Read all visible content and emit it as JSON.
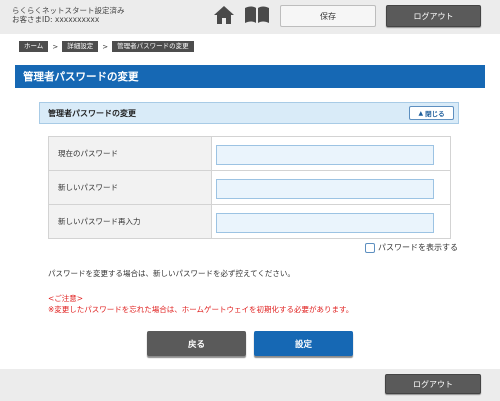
{
  "header": {
    "site_name": "らくらくネットスタート設定済み",
    "customer_id": "お客さまID: xxxxxxxxxx",
    "home_icon": "home-icon",
    "manual_icon": "book-icon",
    "save_label": "保存",
    "logout_label": "ログアウト"
  },
  "breadcrumb": {
    "items": [
      "ホーム",
      "詳細設定",
      "管理者パスワードの変更"
    ],
    "separator": ">"
  },
  "page": {
    "title": "管理者パスワードの変更"
  },
  "section": {
    "title": "管理者パスワードの変更",
    "close_label": "閉じる"
  },
  "form": {
    "fields": [
      {
        "label": "現在のパスワード",
        "value": ""
      },
      {
        "label": "新しいパスワード",
        "value": ""
      },
      {
        "label": "新しいパスワード再入力",
        "value": ""
      }
    ],
    "show_password_label": "パスワードを表示する",
    "show_password_checked": false
  },
  "notes": {
    "info": "パスワードを変更する場合は、新しいパスワードを必ず控えてください。",
    "caution_title": "<ご注意>",
    "caution_text": "※変更したパスワードを忘れた場合は、ホームゲートウェイを初期化する必要があります。"
  },
  "actions": {
    "back_label": "戻る",
    "set_label": "設定"
  },
  "footer": {
    "logout_label": "ログアウト"
  },
  "colors": {
    "primary": "#1668b4",
    "dark_button": "#5a5a5a",
    "section_bg": "#d9ebf8",
    "caution": "#e0201f"
  }
}
